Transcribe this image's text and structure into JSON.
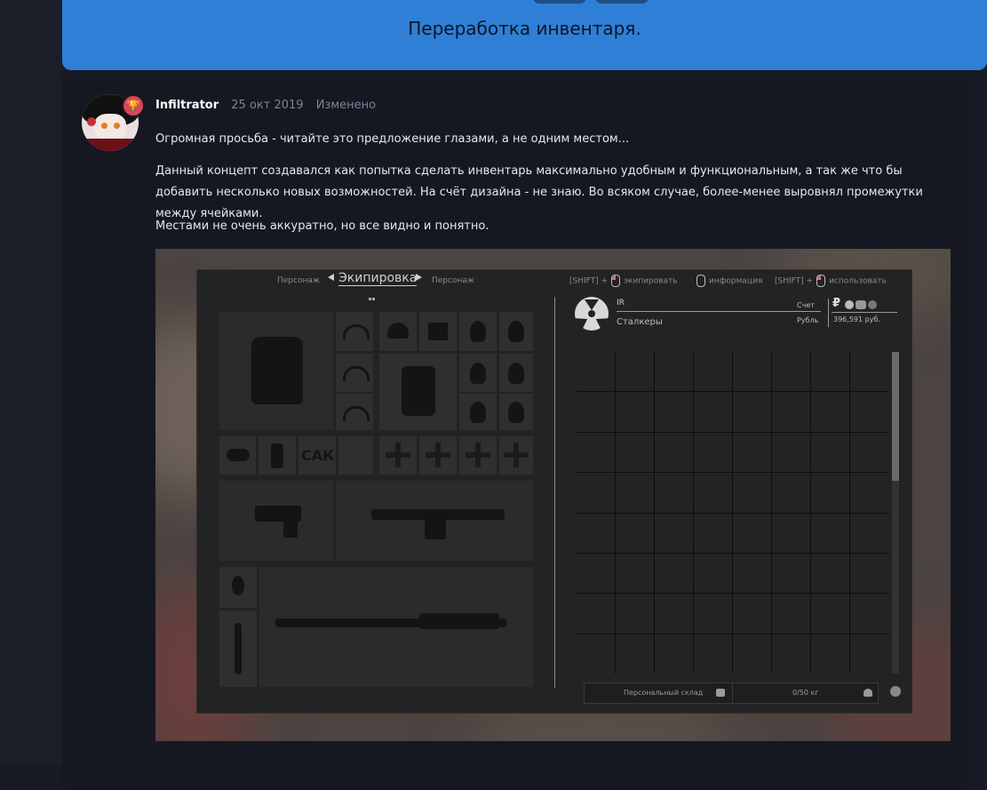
{
  "banner": {
    "title": "Переработка инвентаря."
  },
  "post": {
    "author": "Infiltrator",
    "date": "25 окт 2019",
    "edited": "Изменено",
    "badge_icon": "trophy-icon",
    "paragraphs": [
      "Огромная просьба - читайте это предложение глазами, а не одним местом...",
      "Данный концепт создавался как попытка сделать инвентарь максимально удобным и функциональным, а так же что бы добавить несколько новых возможностей. На счёт дизайна - не знаю. Во всяком случае, более-менее выровнял промежутки между ячейками.",
      "Местами не очень аккуратно, но все видно и понятно."
    ]
  },
  "inventory": {
    "tab_prev": "Персонаж",
    "tab_current": "Экипировка",
    "tab_next": "Персонаж",
    "shift1": "[SHIFT] +",
    "equip": "экипировать",
    "info": "информация",
    "shift2": "[SHIFT] +",
    "use": "использовать",
    "slot_text": "САК",
    "player_name": "IR",
    "faction": "Сталкеры",
    "account_label": "Счет",
    "currency_label": "Рубль",
    "currency_symbol": "₽",
    "money": "396,591 руб.",
    "storage_label": "Персональный склад",
    "weight": "0/50 кг"
  }
}
